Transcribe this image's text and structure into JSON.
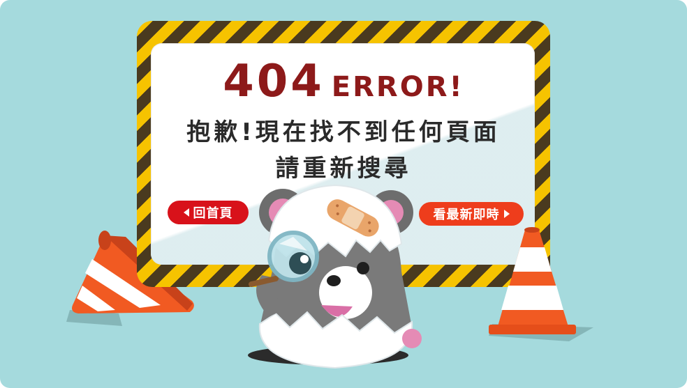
{
  "error": {
    "code": "404",
    "word": "ERROR!",
    "message_line1": "抱歉!現在找不到任何頁面",
    "message_line2": "請重新搜尋"
  },
  "buttons": {
    "home_label": "回首頁",
    "latest_label": "看最新即時"
  },
  "colors": {
    "background": "#a5dadd",
    "hazard_yellow": "#f6c300",
    "hazard_dark": "#4a3a1f",
    "title_red": "#8d1a1a",
    "button_red": "#d8121a",
    "button_orange": "#ee3d1c",
    "cone_orange": "#f15a22"
  },
  "icons": {
    "home_button": "caret-left-icon",
    "latest_button": "caret-right-icon"
  }
}
